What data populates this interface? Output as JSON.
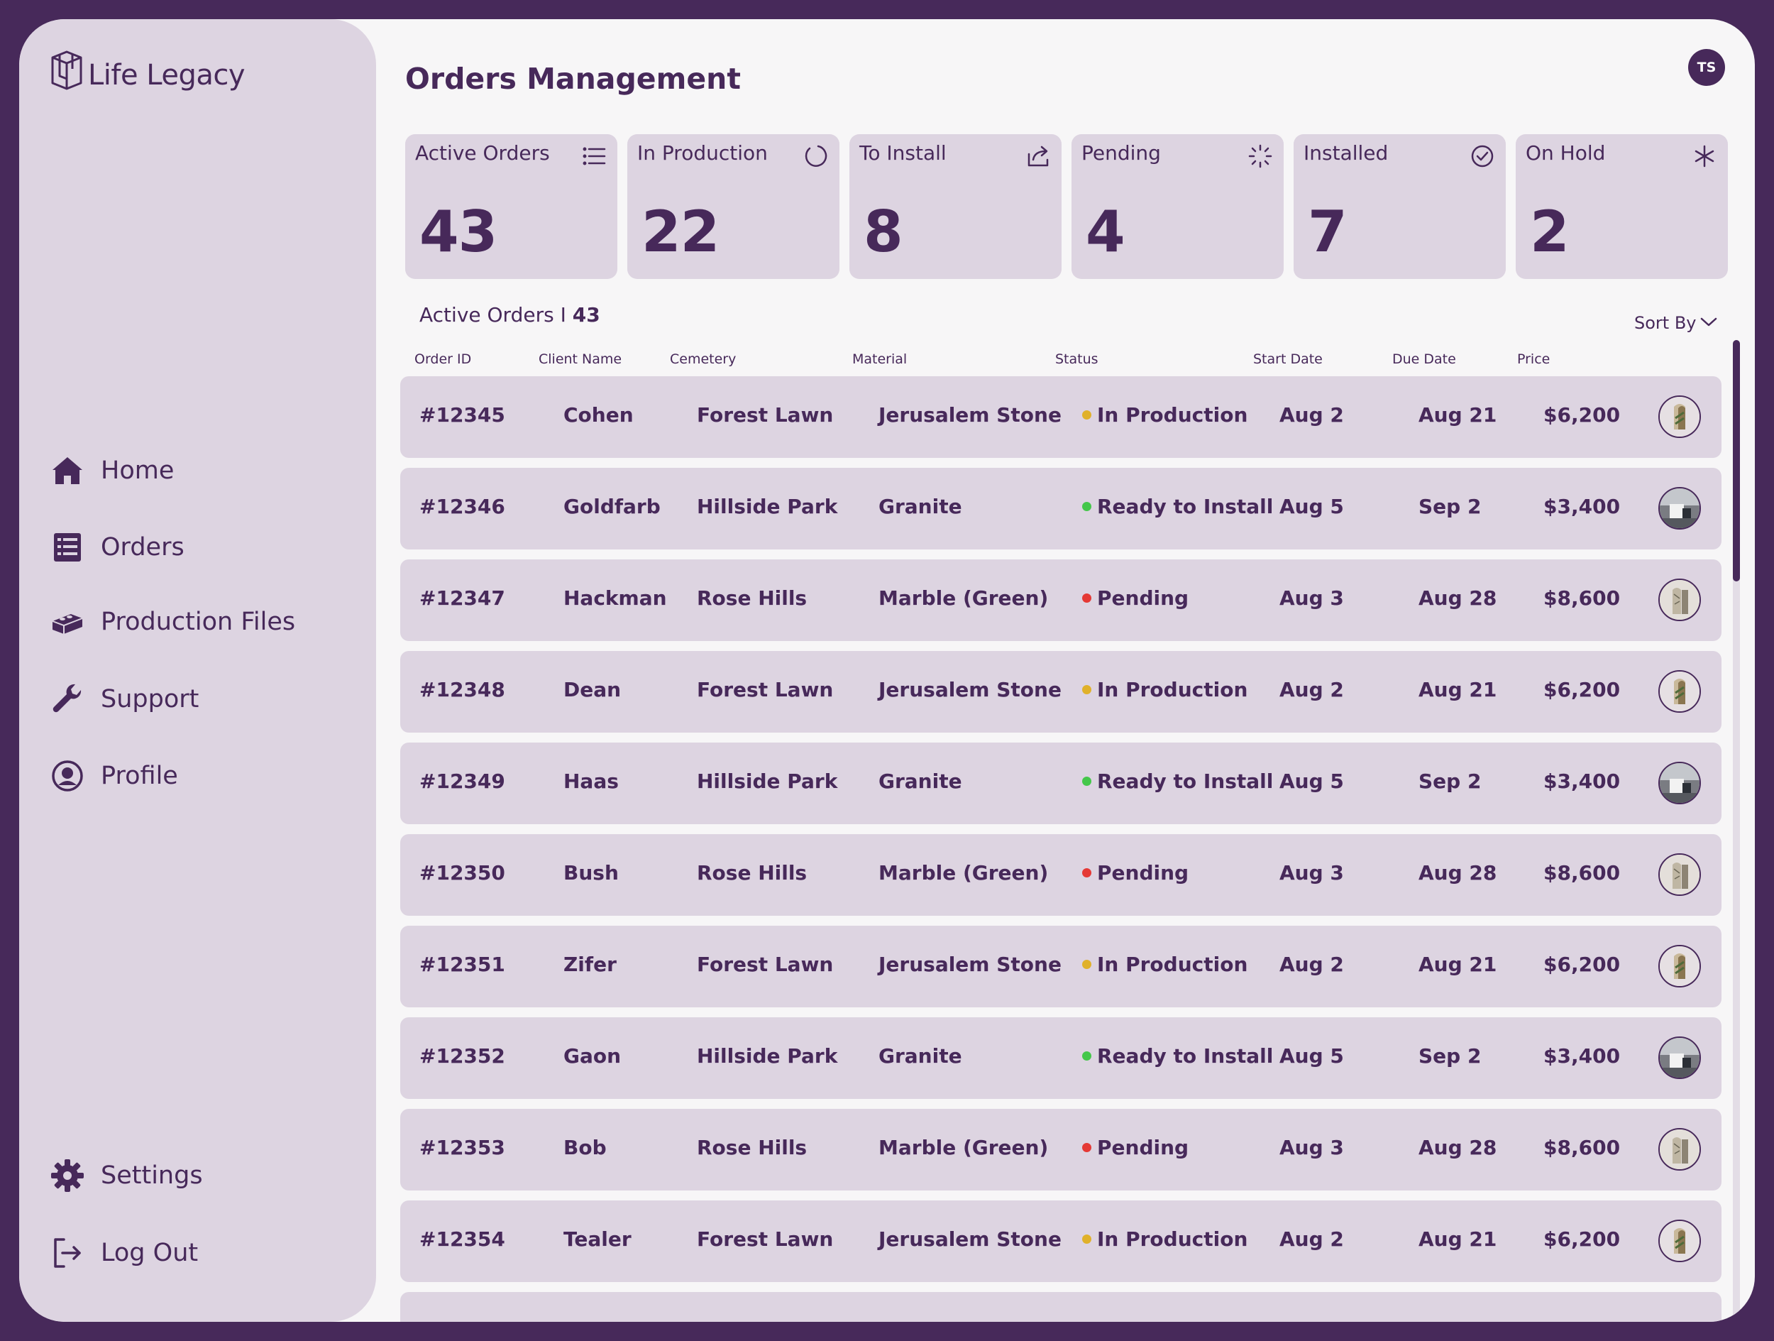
{
  "brand": {
    "name": "Life Legacy"
  },
  "nav": {
    "home": "Home",
    "orders": "Orders",
    "production_files": "Production Files",
    "support": "Support",
    "profile": "Profile",
    "settings": "Settings",
    "logout": "Log Out"
  },
  "header": {
    "title": "Orders Management",
    "avatar_initials": "TS"
  },
  "cards": [
    {
      "label": "Active Orders",
      "value": "43",
      "icon": "list-icon"
    },
    {
      "label": "In Production",
      "value": "22",
      "icon": "loading-circle-icon"
    },
    {
      "label": "To Install",
      "value": "8",
      "icon": "share-icon"
    },
    {
      "label": "Pending",
      "value": "4",
      "icon": "spinner-icon"
    },
    {
      "label": "Installed",
      "value": "7",
      "icon": "check-circle-icon"
    },
    {
      "label": "On Hold",
      "value": "2",
      "icon": "asterisk-icon"
    }
  ],
  "list": {
    "label": "Active Orders I",
    "count": "43",
    "sort_label": "Sort By"
  },
  "columns": {
    "order_id": "Order ID",
    "client": "Client Name",
    "cemetery": "Cemetery",
    "material": "Material",
    "status": "Status",
    "start": "Start Date",
    "due": "Due Date",
    "price": "Price"
  },
  "status_colors": {
    "In Production": "#e0b12a",
    "Ready to Install": "#44c74a",
    "Pending": "#e53935"
  },
  "orders": [
    {
      "id": "#12345",
      "client": "Cohen",
      "cemetery": "Forest Lawn",
      "material": "Jerusalem Stone",
      "status": "In Production",
      "start": "Aug 2",
      "due": "Aug 21",
      "price": "$6,200",
      "thumb": "stone-thumbnail"
    },
    {
      "id": "#12346",
      "client": "Goldfarb",
      "cemetery": "Hillside Park",
      "material": "Granite",
      "status": "Ready to Install",
      "start": "Aug 5",
      "due": "Sep 2",
      "price": "$3,400",
      "thumb": "grave-thumbnail"
    },
    {
      "id": "#12347",
      "client": "Hackman",
      "cemetery": "Rose Hills",
      "material": "Marble (Green)",
      "status": "Pending",
      "start": "Aug 3",
      "due": "Aug 28",
      "price": "$8,600",
      "thumb": "marble-thumbnail"
    },
    {
      "id": "#12348",
      "client": "Dean",
      "cemetery": "Forest Lawn",
      "material": "Jerusalem Stone",
      "status": "In Production",
      "start": "Aug 2",
      "due": "Aug 21",
      "price": "$6,200",
      "thumb": "stone-thumbnail"
    },
    {
      "id": "#12349",
      "client": "Haas",
      "cemetery": "Hillside Park",
      "material": "Granite",
      "status": "Ready to Install",
      "start": "Aug 5",
      "due": "Sep 2",
      "price": "$3,400",
      "thumb": "grave-thumbnail"
    },
    {
      "id": "#12350",
      "client": "Bush",
      "cemetery": "Rose Hills",
      "material": "Marble (Green)",
      "status": "Pending",
      "start": "Aug 3",
      "due": "Aug 28",
      "price": "$8,600",
      "thumb": "marble-thumbnail"
    },
    {
      "id": "#12351",
      "client": "Zifer",
      "cemetery": "Forest Lawn",
      "material": "Jerusalem Stone",
      "status": "In Production",
      "start": "Aug 2",
      "due": "Aug 21",
      "price": "$6,200",
      "thumb": "stone-thumbnail"
    },
    {
      "id": "#12352",
      "client": "Gaon",
      "cemetery": "Hillside Park",
      "material": "Granite",
      "status": "Ready to Install",
      "start": "Aug 5",
      "due": "Sep 2",
      "price": "$3,400",
      "thumb": "grave-thumbnail"
    },
    {
      "id": "#12353",
      "client": "Bob",
      "cemetery": "Rose Hills",
      "material": "Marble (Green)",
      "status": "Pending",
      "start": "Aug 3",
      "due": "Aug 28",
      "price": "$8,600",
      "thumb": "marble-thumbnail"
    },
    {
      "id": "#12354",
      "client": "Tealer",
      "cemetery": "Forest Lawn",
      "material": "Jerusalem Stone",
      "status": "In Production",
      "start": "Aug 2",
      "due": "Aug 21",
      "price": "$6,200",
      "thumb": "stone-thumbnail"
    }
  ]
}
